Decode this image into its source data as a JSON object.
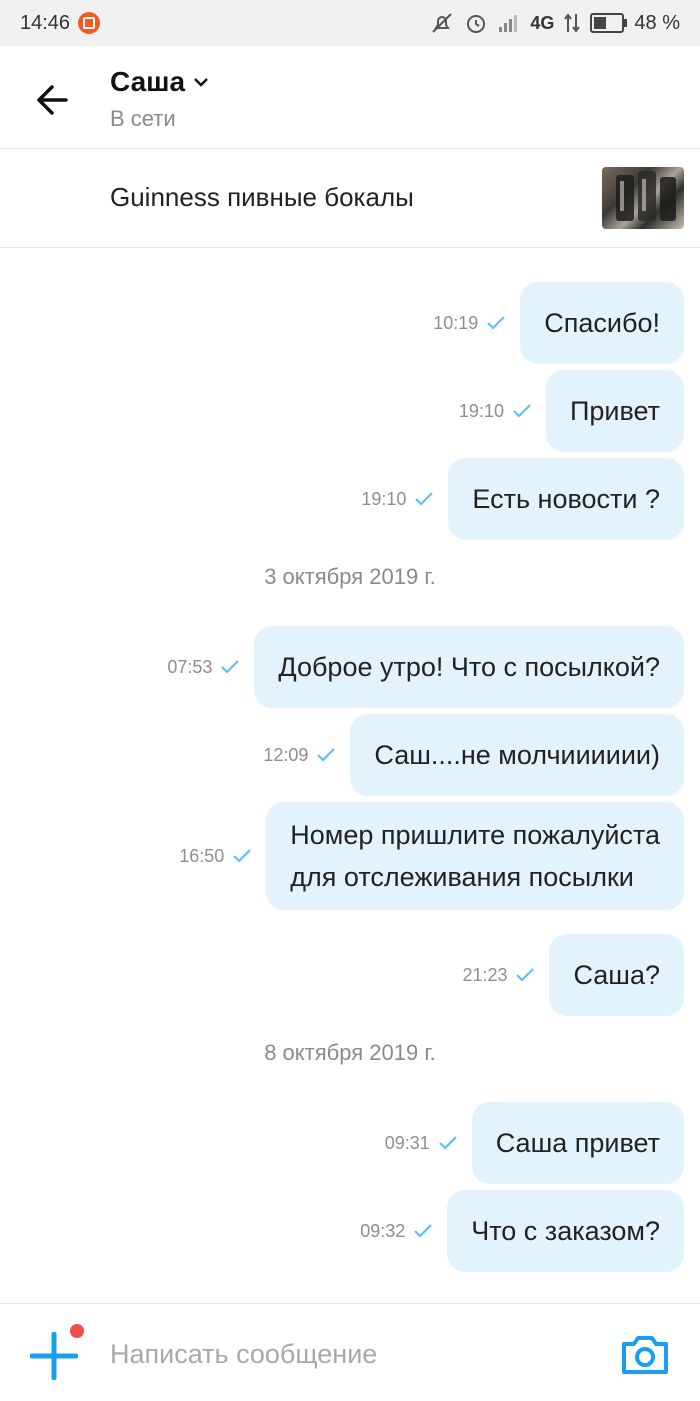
{
  "status_bar": {
    "time": "14:46",
    "network": "4G",
    "battery_pct": "48 %",
    "battery_level": 0.48
  },
  "header": {
    "contact_name": "Саша",
    "contact_status": "В сети"
  },
  "item": {
    "title": "Guinness пивные бокалы"
  },
  "messages": [
    {
      "time": "10:19",
      "lines": [
        "Спасибо!"
      ]
    },
    {
      "time": "19:10",
      "lines": [
        "Привет"
      ]
    },
    {
      "time": "19:10",
      "lines": [
        "Есть новости ?"
      ]
    },
    {
      "date": "3 октября 2019 г."
    },
    {
      "time": "07:53",
      "lines": [
        "Доброе утро! Что с посылкой?"
      ]
    },
    {
      "time": "12:09",
      "lines": [
        "Саш....не молчииииии)"
      ]
    },
    {
      "time": "16:50",
      "lines": [
        "Номер пришлите пожалуйста",
        "для отслеживания посылки"
      ]
    },
    {
      "time": "21:23",
      "lines": [
        "Саша?"
      ]
    },
    {
      "date": "8 октября 2019 г."
    },
    {
      "time": "09:31",
      "lines": [
        "Саша привет"
      ]
    },
    {
      "time": "09:32",
      "lines": [
        "Что с заказом?"
      ]
    }
  ],
  "composer": {
    "placeholder": "Написать сообщение"
  },
  "colors": {
    "accent": "#1a9ff0",
    "bubble": "#e3f3fd",
    "check": "#5bc2f5",
    "dot": "#f04e4e"
  }
}
